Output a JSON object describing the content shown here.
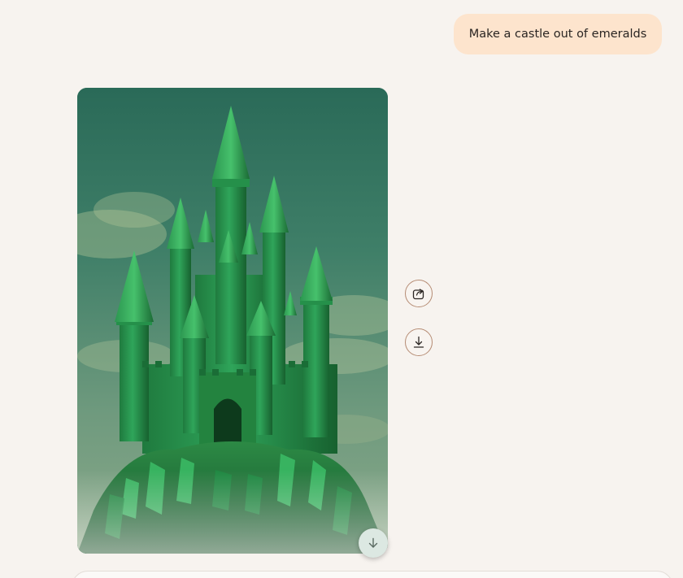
{
  "conversation": {
    "user_message": "Make a castle out of emeralds"
  },
  "generated_image": {
    "description_icon": "emerald-castle-image"
  },
  "actions": {
    "share_icon": "share-icon",
    "download_icon": "download-icon",
    "scroll_down_icon": "arrow-down-icon"
  },
  "colors": {
    "user_bubble": "#fde4cd",
    "page_background": "#f7f3ef",
    "button_border": "#b58b73",
    "emerald": "#2fa55a"
  }
}
